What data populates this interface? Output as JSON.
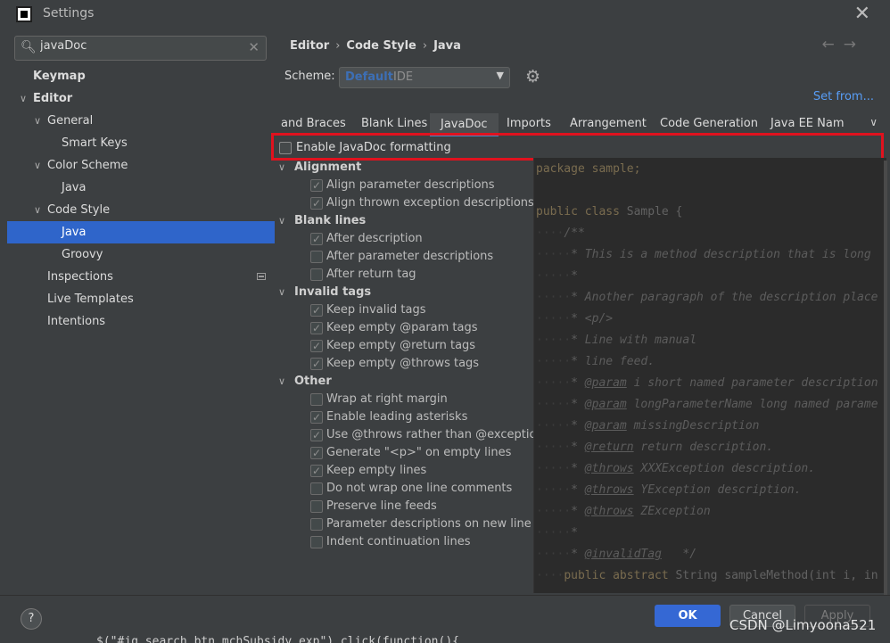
{
  "window": {
    "title": "Settings",
    "close_icon": "close-icon"
  },
  "search": {
    "value": "javaDoc"
  },
  "sidebar": {
    "items": [
      {
        "label": "Keymap"
      },
      {
        "label": "Editor"
      },
      {
        "label": "General"
      },
      {
        "label": "Smart Keys"
      },
      {
        "label": "Color Scheme"
      },
      {
        "label": "Java"
      },
      {
        "label": "Code Style"
      },
      {
        "label": "Java",
        "selected": true
      },
      {
        "label": "Groovy"
      },
      {
        "label": "Inspections"
      },
      {
        "label": "Live Templates"
      },
      {
        "label": "Intentions"
      }
    ]
  },
  "breadcrumb": {
    "editor": "Editor",
    "code_style": "Code Style",
    "java": "Java"
  },
  "scheme": {
    "label": "Scheme:",
    "default": "Default",
    "ide": "IDE"
  },
  "set_from": "Set from...",
  "tabs": {
    "braces": "and Braces",
    "blank_lines": "Blank Lines",
    "javadoc": "JavaDoc",
    "imports": "Imports",
    "arrangement": "Arrangement",
    "code_generation": "Code Generation",
    "java_ee": "Java EE Nam"
  },
  "enable_javadoc": {
    "label": "Enable JavaDoc formatting",
    "checked": false
  },
  "groups": {
    "alignment": "Alignment",
    "blank_lines": "Blank lines",
    "invalid_tags": "Invalid tags",
    "other": "Other"
  },
  "options": {
    "align_param": "Align parameter descriptions",
    "align_thrown": "Align thrown exception descriptions",
    "after_description": "After description",
    "after_param": "After parameter descriptions",
    "after_return": "After return tag",
    "keep_invalid": "Keep invalid tags",
    "keep_empty_param": "Keep empty @param tags",
    "keep_empty_return": "Keep empty @return tags",
    "keep_empty_throws": "Keep empty @throws tags",
    "wrap_margin": "Wrap at right margin",
    "leading_asterisks": "Enable leading asterisks",
    "use_throws": "Use @throws rather than @exception",
    "generate_p": "Generate \"<p>\" on empty lines",
    "keep_empty_lines": "Keep empty lines",
    "no_wrap_one_line": "Do not wrap one line comments",
    "preserve_feeds": "Preserve line feeds",
    "param_new_line": "Parameter descriptions on new line",
    "indent_continuation": "Indent continuation lines"
  },
  "code": {
    "package": "package sample;",
    "class_kw": "public class",
    "class_name": " Sample {",
    "open": "/**",
    "l1": "* This is a method description that is long",
    "l2": "*",
    "l3": "* Another paragraph of the description place",
    "l4": "* <p/>",
    "l5": "* Line with manual",
    "l6": "* line feed.",
    "p1_tag": "@param",
    "p1_text": " i short named parameter description",
    "p2_tag": "@param",
    "p2_text": " longParameterName long named parame",
    "p3_tag": "@param",
    "p3_text": " missingDescription",
    "r_tag": "@return",
    "r_text": " return description.",
    "t1_tag": "@throws",
    "t1_text": " XXXException description.",
    "t2_tag": "@throws",
    "t2_text": " YException description.",
    "t3_tag": "@throws",
    "t3_text": " ZException",
    "l7": "*",
    "inv_tag": "@invalidTag",
    "inv_close": "   */",
    "method_kw": "public abstract",
    "method_rest": " String sampleMethod(int i, in"
  },
  "buttons": {
    "help": "?",
    "ok": "OK",
    "cancel": "Cancel",
    "apply": "Apply"
  },
  "watermark": "CSDN @Limyoona521",
  "bg_code": "$(\"#jq_search_btn_mchSubsidy_exp\").click(function(){"
}
